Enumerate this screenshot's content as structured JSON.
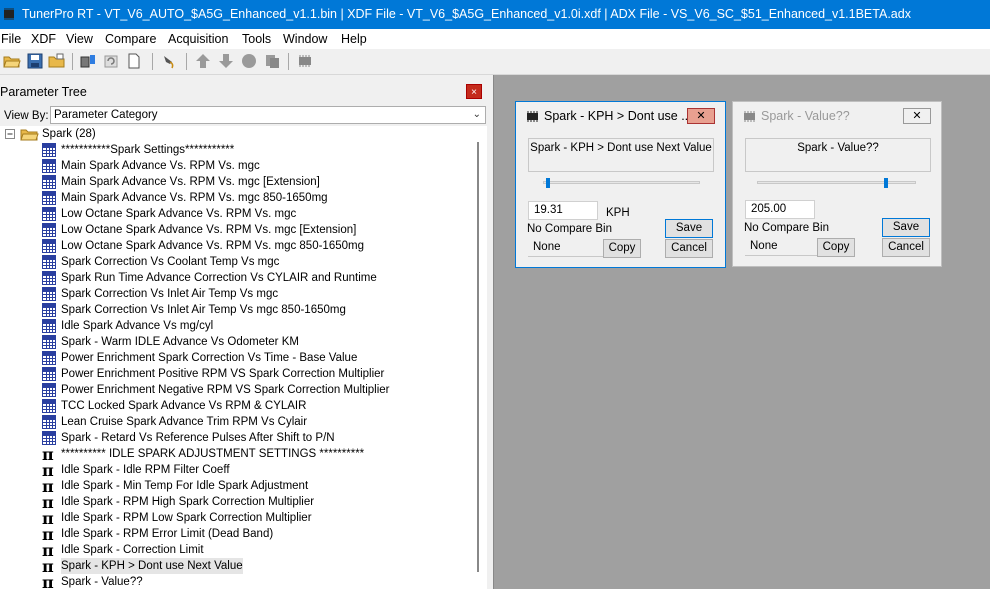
{
  "window": {
    "title": "TunerPro RT - VT_V6_AUTO_$A5G_Enhanced_v1.1.bin | XDF File - VT_V6_$A5G_Enhanced_v1.0i.xdf | ADX File - VS_V6_SC_$51_Enhanced_v1.1BETA.adx"
  },
  "menu": [
    "File",
    "XDF",
    "View",
    "Compare",
    "Acquisition",
    "Tools",
    "Window",
    "Help"
  ],
  "toolbar": {
    "icons": [
      "open-folder-icon",
      "save-icon",
      "open-icon",
      "chip-download-icon",
      "refresh-icon",
      "new-document-icon",
      "probe-icon",
      "up-arrow-icon",
      "down-arrow-icon",
      "record-icon",
      "copy-icon",
      "chip-icon"
    ]
  },
  "param_tree": {
    "title": "Parameter Tree",
    "close": "×",
    "view_by_label": "View By:",
    "view_by_value": "Parameter Category",
    "root_label": "Spark (28)",
    "items": [
      {
        "icon": "table",
        "label": "***********Spark Settings***********"
      },
      {
        "icon": "table",
        "label": "Main Spark Advance Vs. RPM Vs. mgc"
      },
      {
        "icon": "table",
        "label": "Main Spark Advance Vs. RPM Vs. mgc [Extension]"
      },
      {
        "icon": "table",
        "label": "Main Spark Advance Vs. RPM Vs. mgc 850-1650mg"
      },
      {
        "icon": "table",
        "label": "Low Octane Spark Advance Vs. RPM Vs. mgc"
      },
      {
        "icon": "table",
        "label": "Low Octane Spark Advance Vs. RPM Vs. mgc [Extension]"
      },
      {
        "icon": "table",
        "label": "Low Octane Spark Advance Vs. RPM Vs. mgc 850-1650mg"
      },
      {
        "icon": "table",
        "label": "Spark Correction Vs Coolant Temp Vs mgc"
      },
      {
        "icon": "table",
        "label": "Spark Run Time Advance Correction Vs CYLAIR and Runtime"
      },
      {
        "icon": "table",
        "label": "Spark Correction Vs Inlet Air Temp Vs mgc"
      },
      {
        "icon": "table",
        "label": "Spark Correction Vs Inlet Air Temp Vs mgc 850-1650mg"
      },
      {
        "icon": "table",
        "label": "Idle Spark Advance Vs mg/cyl"
      },
      {
        "icon": "table",
        "label": "Spark - Warm IDLE Advance Vs Odometer KM"
      },
      {
        "icon": "table",
        "label": "Power Enrichment Spark Correction Vs Time - Base Value"
      },
      {
        "icon": "table",
        "label": "Power Enrichment Positive RPM VS Spark Correction Multiplier"
      },
      {
        "icon": "table",
        "label": "Power Enrichment Negative RPM VS Spark Correction Multiplier"
      },
      {
        "icon": "table",
        "label": "TCC Locked Spark Advance Vs RPM & CYLAIR"
      },
      {
        "icon": "table",
        "label": "Lean Cruise Spark Advance Trim RPM Vs Cylair"
      },
      {
        "icon": "table",
        "label": "Spark - Retard Vs Reference Pulses After Shift to P/N"
      },
      {
        "icon": "pi",
        "label": "********** IDLE SPARK ADJUSTMENT SETTINGS **********"
      },
      {
        "icon": "pi",
        "label": "Idle Spark - Idle RPM Filter Coeff"
      },
      {
        "icon": "pi",
        "label": "Idle Spark - Min Temp For Idle Spark Adjustment"
      },
      {
        "icon": "pi",
        "label": "Idle Spark - RPM High Spark Correction Multiplier"
      },
      {
        "icon": "pi",
        "label": "Idle Spark - RPM Low Spark Correction Multiplier"
      },
      {
        "icon": "pi",
        "label": "Idle Spark - RPM Error Limit (Dead Band)"
      },
      {
        "icon": "pi",
        "label": "Idle Spark - Correction Limit"
      },
      {
        "icon": "pi",
        "label": "Spark - KPH > Dont use Next Value"
      },
      {
        "icon": "pi",
        "label": "Spark - Value??"
      }
    ]
  },
  "dialog1": {
    "title": "Spark - KPH > Dont use ...",
    "close": "✕",
    "description": "Spark - KPH > Dont use Next Value",
    "slider_fraction": 0.02,
    "value": "19.31",
    "unit": "KPH",
    "compare_label": "No Compare Bin",
    "compare_value": "None",
    "save": "Save",
    "copy": "Copy",
    "cancel": "Cancel"
  },
  "dialog2": {
    "title": "Spark - Value??",
    "close": "✕",
    "description": "Spark - Value??",
    "slider_fraction": 0.8,
    "value": "205.00",
    "unit": "",
    "compare_label": "No Compare Bin",
    "compare_value": "None",
    "save": "Save",
    "copy": "Copy",
    "cancel": "Cancel"
  }
}
